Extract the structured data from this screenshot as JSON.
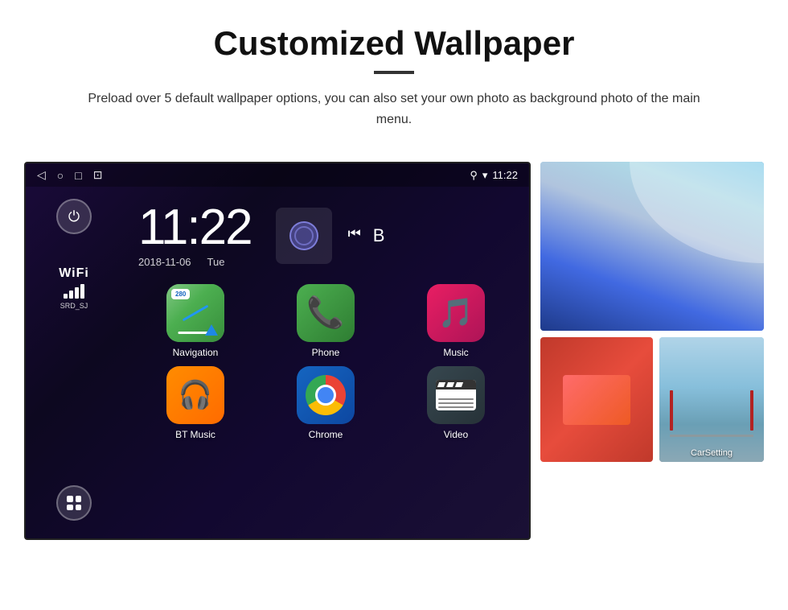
{
  "header": {
    "title": "Customized Wallpaper",
    "subtitle": "Preload over 5 default wallpaper options, you can also set your own photo as background photo of the main menu."
  },
  "android": {
    "statusBar": {
      "time": "11:22",
      "wifi": "WiFi",
      "ssid": "SRD_SJ",
      "signal_bars": 3
    },
    "clock": {
      "time": "11:22",
      "date": "2018-11-06",
      "day": "Tue"
    },
    "apps": [
      {
        "id": "navigation",
        "label": "Navigation",
        "badge": "280"
      },
      {
        "id": "phone",
        "label": "Phone"
      },
      {
        "id": "music",
        "label": "Music"
      },
      {
        "id": "bt-music",
        "label": "BT Music"
      },
      {
        "id": "chrome",
        "label": "Chrome"
      },
      {
        "id": "video",
        "label": "Video"
      }
    ]
  },
  "wallpapers": {
    "label_carsetting": "CarSetting"
  }
}
